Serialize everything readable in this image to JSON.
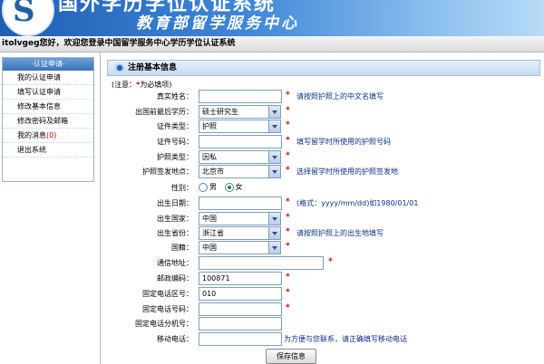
{
  "header": {
    "title": "国外学历学位认证系统",
    "subtitle": "教育部留学服务中心"
  },
  "welcome": "itolvgeg您好，欢迎您登录中国留学服务中心学历学位认证系统",
  "sidebar": {
    "heading": "-认证申请-",
    "items": [
      {
        "label": "我的认证申请"
      },
      {
        "label": "填写认证申请"
      },
      {
        "label": "修改基本信息"
      },
      {
        "label": "修改密码及邮箱"
      },
      {
        "label": "我的消息",
        "count": "(0)"
      },
      {
        "label": "退出系统"
      }
    ]
  },
  "panel": {
    "title": "注册基本信息",
    "note_prefix": "(注意：",
    "note_star": "*",
    "note_suffix": "为必填项)"
  },
  "form": {
    "real_name": {
      "label": "真实姓名：",
      "value": "",
      "hint": "请按照护照上的中文名填写"
    },
    "education": {
      "label": "出国前最后学历：",
      "value": "硕士研究生"
    },
    "id_type": {
      "label": "证件类型：",
      "value": "护照"
    },
    "id_number": {
      "label": "证件号码：",
      "value": "",
      "hint": "填写留学时所使用的护照号码"
    },
    "passport_type": {
      "label": "护照类型：",
      "value": "因私"
    },
    "passport_place": {
      "label": "护照签发地点：",
      "value": "北京市",
      "hint": "选择留学时所使用的护照签发地"
    },
    "gender": {
      "label": "性别：",
      "options": [
        "男",
        "女"
      ],
      "selected": "女"
    },
    "birth_date": {
      "label": "出生日期：",
      "value": "",
      "hint": "(格式：yyyy/mm/dd)如1980/01/01"
    },
    "birth_country": {
      "label": "出生国家：",
      "value": "中国"
    },
    "birth_province": {
      "label": "出生省份：",
      "value": "浙江省",
      "hint": "请按照护照上的出生地填写"
    },
    "nationality": {
      "label": "国籍：",
      "value": "中国"
    },
    "address": {
      "label": "通信地址：",
      "value": ""
    },
    "postcode": {
      "label": "邮政编码：",
      "value": "100871"
    },
    "phone_area": {
      "label": "固定电话区号：",
      "value": "010"
    },
    "phone_number": {
      "label": "固定电话号码：",
      "value": ""
    },
    "phone_ext": {
      "label": "固定电话分机号：",
      "value": ""
    },
    "mobile": {
      "label": "移动电话：",
      "value": "",
      "hint": "为方便与您联系，请正确填写移动电话"
    },
    "required_mark": "*"
  },
  "save_button": "保存信息"
}
